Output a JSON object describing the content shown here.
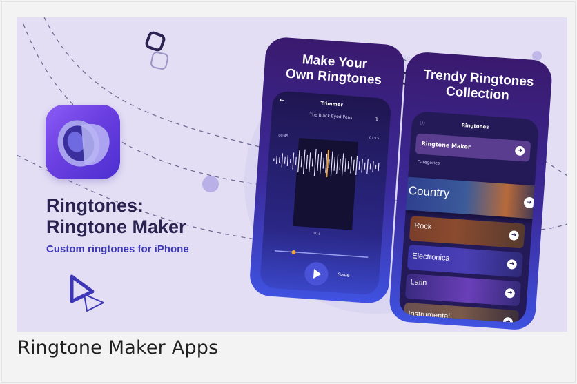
{
  "banner": {
    "app_title_line1": "Ringtones:",
    "app_title_line2": "Ringtone Maker",
    "app_subtitle": "Custom ringtones for iPhone",
    "icon": "speaker-icon",
    "brand_color": "#3d37b8"
  },
  "phone_left": {
    "headline_line1": "Make Your",
    "headline_line2": "Own Ringtones",
    "screen_title": "Trimmer",
    "back_icon": "←",
    "track_name": "The Black Eyed Peas",
    "share_icon": "⇪",
    "time_start": "00:45",
    "time_end": "01:15",
    "selection_length": "30 s",
    "save_label": "Save"
  },
  "phone_right": {
    "headline_line1": "Trendy Ringtones",
    "headline_line2": "Collection",
    "info_icon": "ⓘ",
    "screen_title": "Ringtones",
    "maker_label": "Ringtone Maker",
    "categories_label": "Categories",
    "arrow": "➜",
    "categories": [
      "Country",
      "Rock",
      "Electronica",
      "Latin",
      "Instrumental"
    ]
  },
  "caption": "Ringtone Maker Apps"
}
